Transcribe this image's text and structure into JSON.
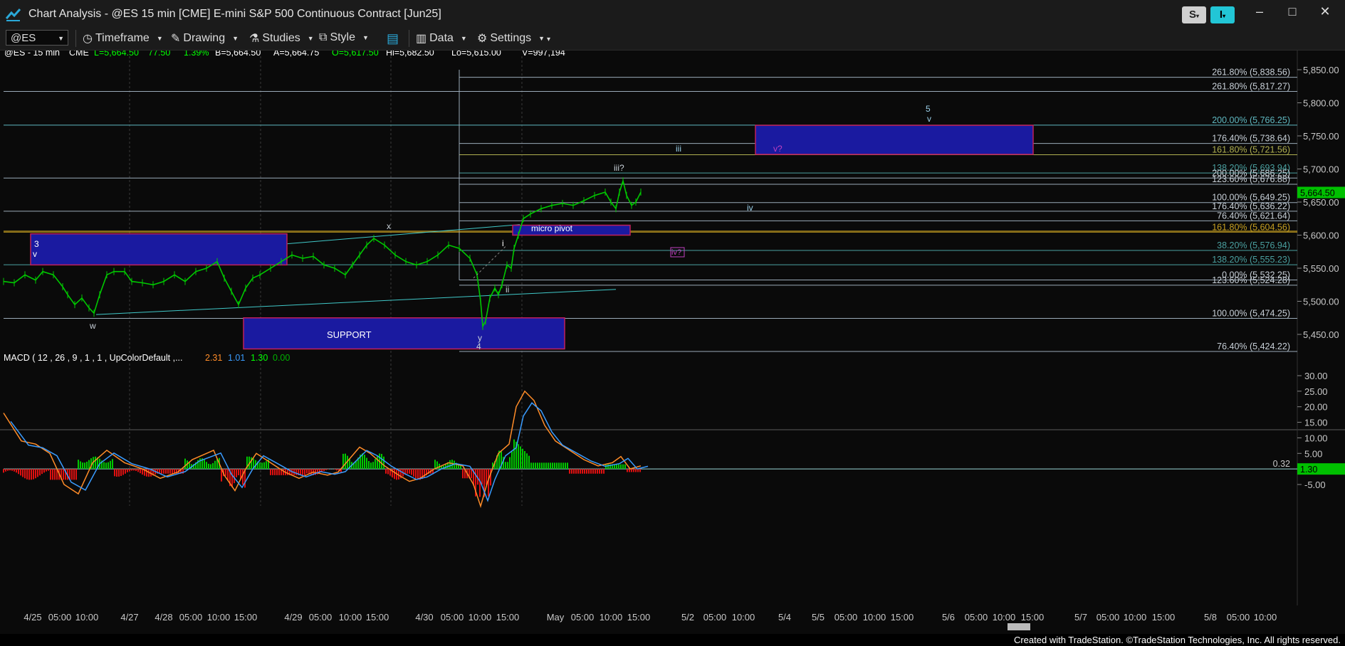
{
  "window": {
    "title": "Chart Analysis - @ES 15 min [CME] E-mini S&P 500 Continuous Contract [Jun25]",
    "s_button": "S",
    "i_button": "I",
    "minimize": "–",
    "maximize": "□",
    "close": "✕"
  },
  "toolbar": {
    "symbol": "@ES",
    "timeframe": "Timeframe",
    "drawing": "Drawing",
    "studies": "Studies",
    "style": "Style",
    "data": "Data",
    "settings": "Settings"
  },
  "header": {
    "symbol": "@ES - 15 min",
    "exchange": "CME",
    "last": "L=5,664.50",
    "change": "77.50",
    "change_pct": "1.39%",
    "bid": "B=5,664.50",
    "ask": "A=5,664.75",
    "open": "O=5,617.50",
    "high": "Hi=5,682.50",
    "low": "Lo=5,615.00",
    "volume": "V=997,194"
  },
  "price_axis": {
    "ticks": [
      "5,850.00",
      "5,800.00",
      "5,750.00",
      "5,700.00",
      "5,650.00",
      "5,600.00",
      "5,550.00",
      "5,500.00",
      "5,450.00"
    ],
    "current": "5,664.50"
  },
  "fib_labels": [
    "261.80% (5,838.56)",
    "261.80% (5,817.27)",
    "200.00% (5,766.25)",
    "176.40% (5,738.64)",
    "161.80% (5,721.56)",
    "138.20% (5,693.94)",
    "200.00% (5,686.25)",
    "123.60% (5,676.88)",
    "100.00% (5,649.25)",
    "176.40% (5,636.22)",
    "76.40% (5,621.64)",
    "161.80% (5,604.56)",
    "38.20% (5,576.94)",
    "138.20% (5,555.23)",
    "0.00% (5,532.25)",
    "123.60% (5,524.28)",
    "100.00% (5,474.25)",
    "76.40% (5,424.22)"
  ],
  "annotations": {
    "wave_3": "3",
    "wave_v_left": "v",
    "wave_w": "w",
    "wave_x": "x",
    "wave_y": "y",
    "wave_4": "4",
    "wave_i": "i",
    "wave_ii": "ii",
    "wave_iii_q": "iii?",
    "wave_iii": "iii",
    "wave_iv": "iv",
    "wave_iv_q": "iv?",
    "wave_v_q": "v?",
    "wave_5": "5",
    "wave_v": "v",
    "micro_pivot": "micro pivot",
    "support": "SUPPORT"
  },
  "macd": {
    "label": "MACD ( 12 , 26 , 9 , 1 , 1 , UpColorDefault ,...",
    "v1": "2.31",
    "v2": "1.01",
    "v3": "1.30",
    "v4": "0.00",
    "ticks": [
      "30.00",
      "25.00",
      "20.00",
      "15.00",
      "10.00",
      "5.00",
      "-5.00"
    ],
    "zero_label": "0.32",
    "current": "1.30"
  },
  "time_axis": [
    "4/25",
    "05:00",
    "10:00",
    "4/27",
    "4/28",
    "05:00",
    "10:00",
    "15:00",
    "4/29",
    "05:00",
    "10:00",
    "15:00",
    "4/30",
    "05:00",
    "10:00",
    "15:00",
    "May",
    "05:00",
    "10:00",
    "15:00",
    "5/2",
    "05:00",
    "10:00",
    "5/4",
    "5/5",
    "05:00",
    "10:00",
    "15:00",
    "5/6",
    "05:00",
    "10:00",
    "15:00",
    "5/7",
    "05:00",
    "10:00",
    "15:00",
    "5/8",
    "05:00",
    "10:00"
  ],
  "footer": "Created with TradeStation. ©TradeStation Technologies, Inc. All rights reserved.",
  "colors": {
    "up": "#00c800",
    "down": "#e01010",
    "box_fill": "#1a1aa0",
    "box_border": "#c0205a",
    "fib_line": "#8aa0b0",
    "green_label": "#00ff00"
  }
}
